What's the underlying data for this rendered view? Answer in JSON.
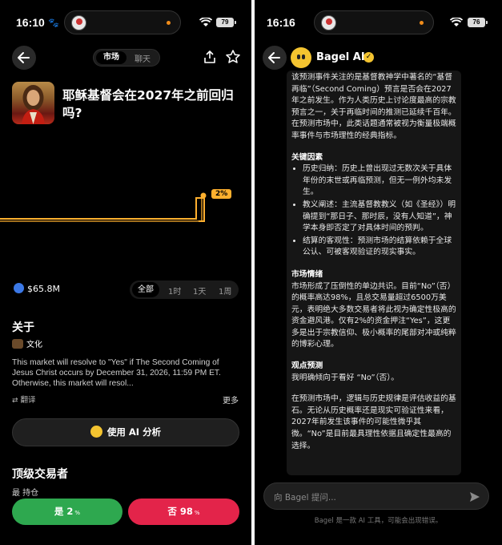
{
  "left": {
    "status": {
      "time": "16:10",
      "battery": "79"
    },
    "tabs": [
      {
        "label": "市场"
      },
      {
        "label": "聊天"
      }
    ],
    "market_title": "耶稣基督会在2027年之前回归吗?",
    "probability_chip": "2%",
    "volume": "$65.8M",
    "ranges": [
      "全部",
      "1时",
      "1天",
      "1周"
    ],
    "about_heading": "关于",
    "category": "文化",
    "description": "This market will resolve to \"Yes\" if The Second Coming of Jesus Christ occurs by December 31, 2026, 11:59 PM ET. Otherwise, this market will resol...",
    "translate_label": "翻译",
    "more_label": "更多",
    "ai_button": "使用 AI 分析",
    "top_traders_heading": "顶级交易者",
    "holders_label": "最 持仓",
    "yes_button": {
      "label": "是 2",
      "suffix": "%"
    },
    "no_button": {
      "label": "否 98",
      "suffix": "%"
    },
    "chart_color": "#ffb02e"
  },
  "right": {
    "status": {
      "time": "16:16",
      "battery": "76"
    },
    "header_title": "Bagel AI",
    "chat": {
      "intro": "该预测事件关注的是基督教神学中著名的“基督再临”（Second Coming）预言是否会在2027年之前发生。作为人类历史上讨论度最高的宗教预言之一，关于再临时间的推测已延续千百年。在预测市场中，此类话题通常被视为衡量极端概率事件与市场理性的经典指标。",
      "key_factors_heading": "关键因素",
      "factors": [
        "历史归纳：历史上曾出现过无数次关于具体年份的末世或再临预测，但无一例外均未发生。",
        "教义阐述：主流基督教教义（如《圣经》）明确提到“那日子、那时辰，没有人知道”，神学本身即否定了对具体时间的预判。",
        "结算的客观性：预测市场的结算依赖于全球公认、可被客观验证的现实事实。"
      ],
      "sentiment_heading": "市场情绪",
      "sentiment": "市场形成了压倒性的单边共识。目前“No”（否）的概率高达98%，且总交易量超过6500万美元，表明绝大多数交易者将此视为确定性极高的资金避风港。仅有2%的资金押注“Yes”，这更多是出于宗教信仰、极小概率的尾部对冲或纯粹的博彩心理。",
      "forecast_heading": "观点预测",
      "forecast": "我明确倾向于看好 “No”（否）。",
      "conclusion": "在预测市场中，逻辑与历史规律是评估收益的基石。无论从历史概率还是现实可验证性来看，2027年前发生该事件的可能性微乎其微。“No”是目前最具理性依据且确定性最高的选择。"
    },
    "input_placeholder": "向 Bagel 提问...",
    "disclaimer": "Bagel 是一款 AI 工具，可能会出现错误。",
    "accent_color": "#f4c430"
  }
}
